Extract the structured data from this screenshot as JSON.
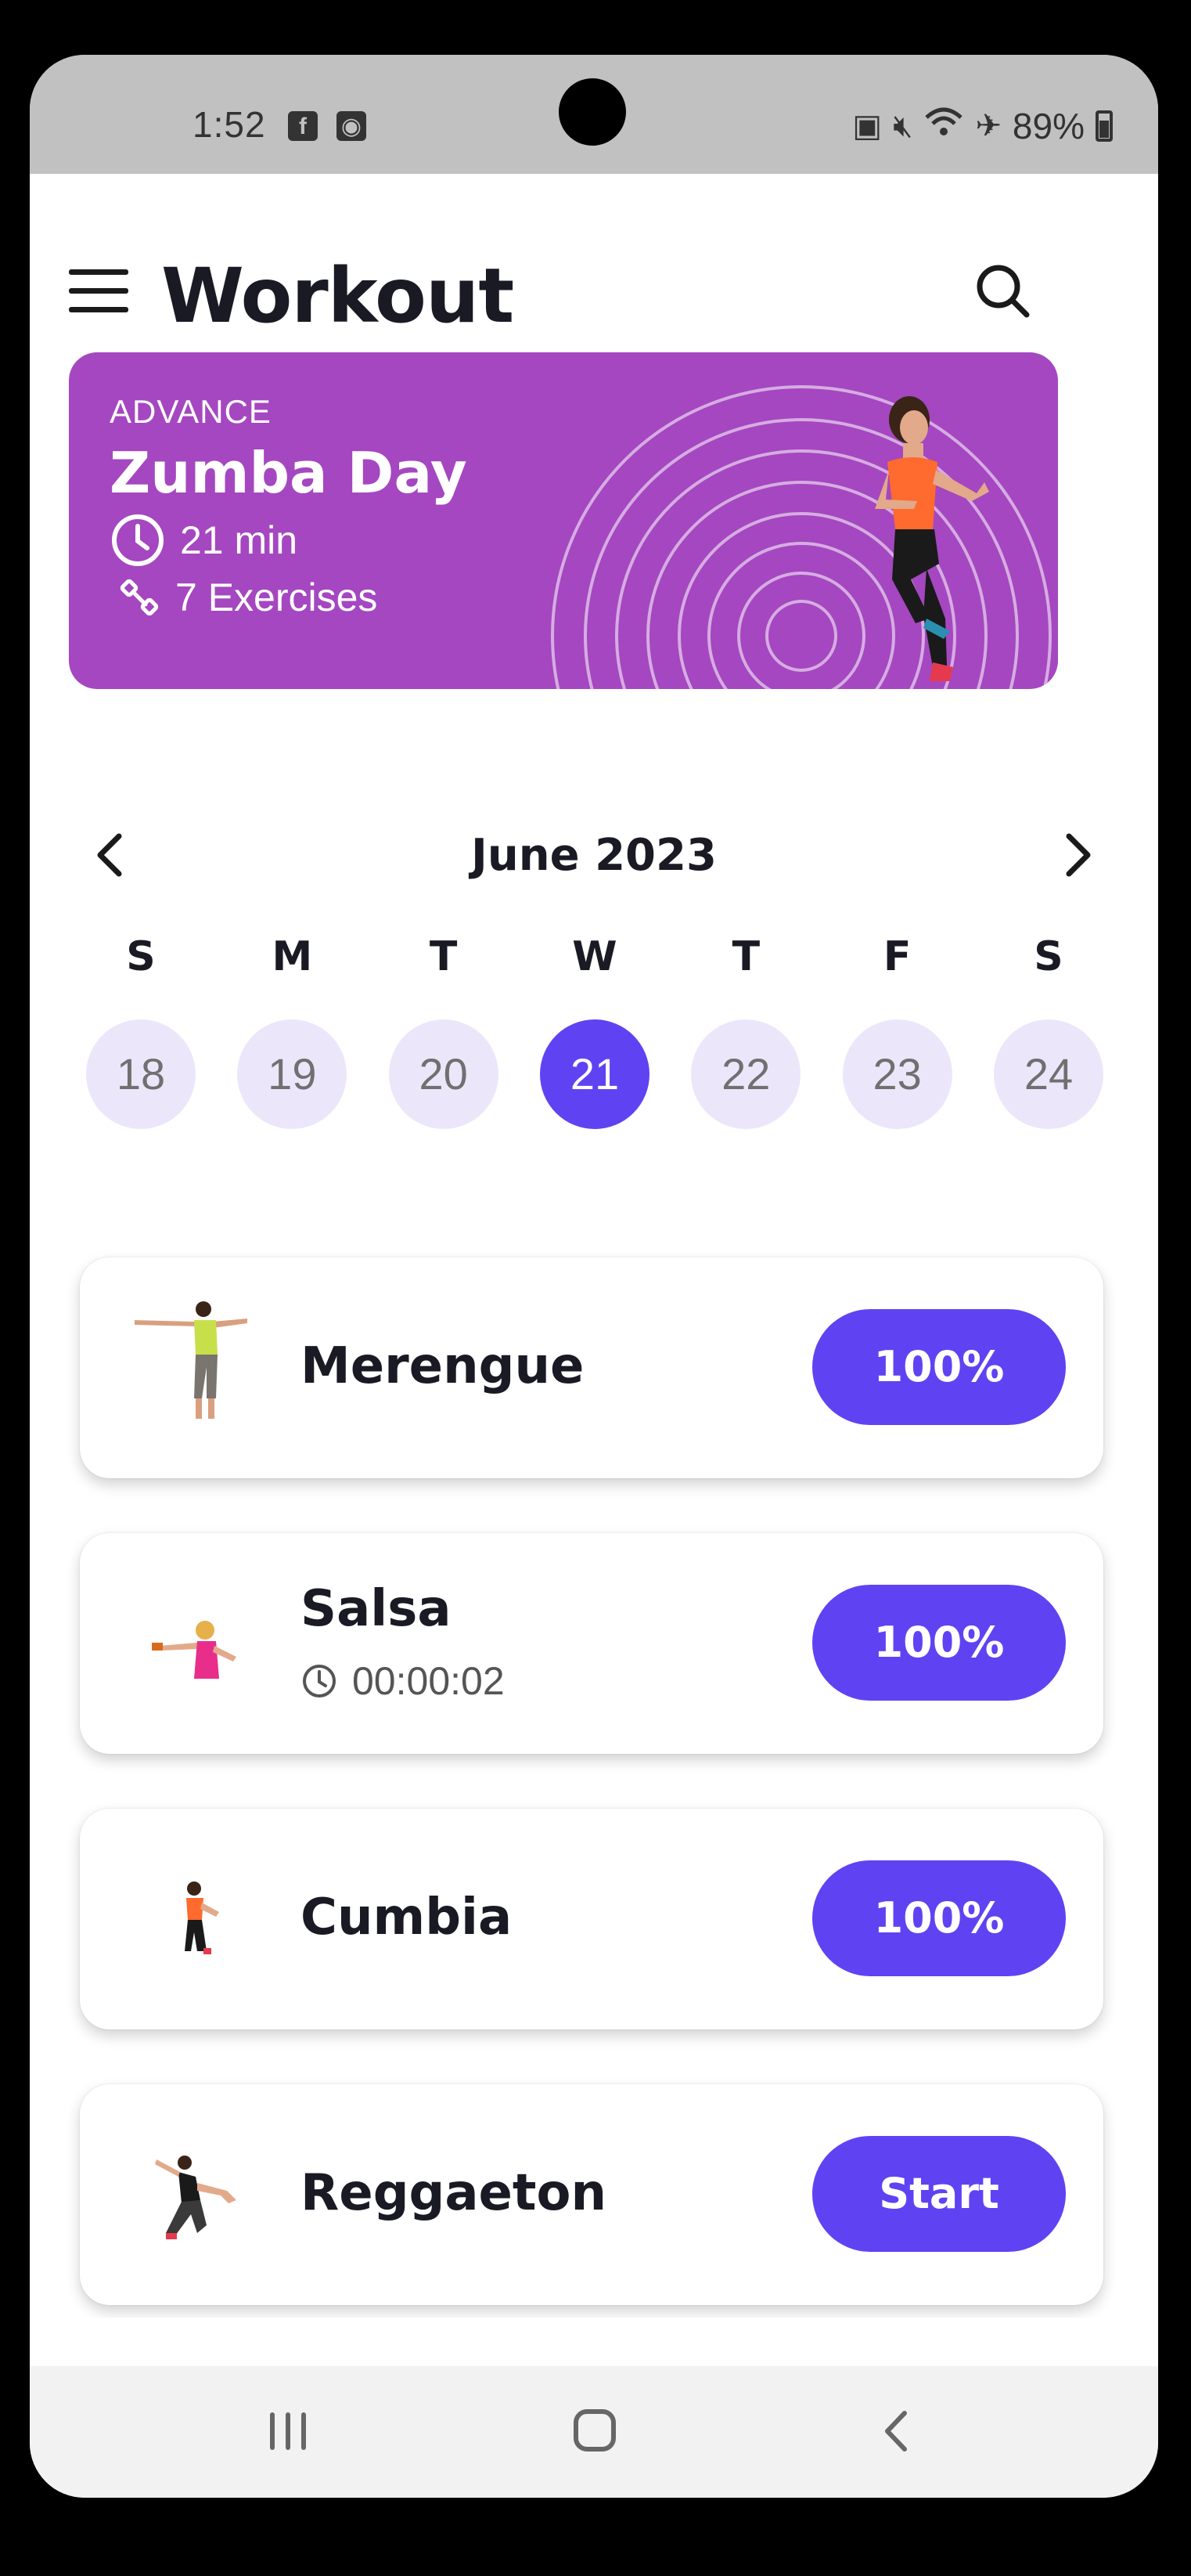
{
  "status_bar": {
    "time": "1:52",
    "battery": "89%"
  },
  "header": {
    "title": "Workout"
  },
  "hero": {
    "level": "ADVANCE",
    "name": "Zumba Day",
    "duration": "21 min",
    "exercises": "7 Exercises"
  },
  "calendar": {
    "month": "June 2023",
    "weekdays": [
      "S",
      "M",
      "T",
      "W",
      "T",
      "F",
      "S"
    ],
    "dates": [
      "18",
      "19",
      "20",
      "21",
      "22",
      "23",
      "24"
    ],
    "selected": "21"
  },
  "workouts": [
    {
      "name": "Merengue",
      "action": "100%"
    },
    {
      "name": "Salsa",
      "time": "00:00:02",
      "action": "100%"
    },
    {
      "name": "Cumbia",
      "action": "100%"
    },
    {
      "name": "Reggaeton",
      "action": "Start"
    }
  ],
  "colors": {
    "accent": "#5f43f2",
    "hero": "#a547c0",
    "date_bg": "#ece6fb"
  },
  "icons": {
    "menu": "hamburger-menu-icon",
    "search": "search-icon",
    "clock": "clock-icon",
    "dumbbell": "dumbbell-icon",
    "prev": "chevron-left-icon",
    "next": "chevron-right-icon"
  }
}
